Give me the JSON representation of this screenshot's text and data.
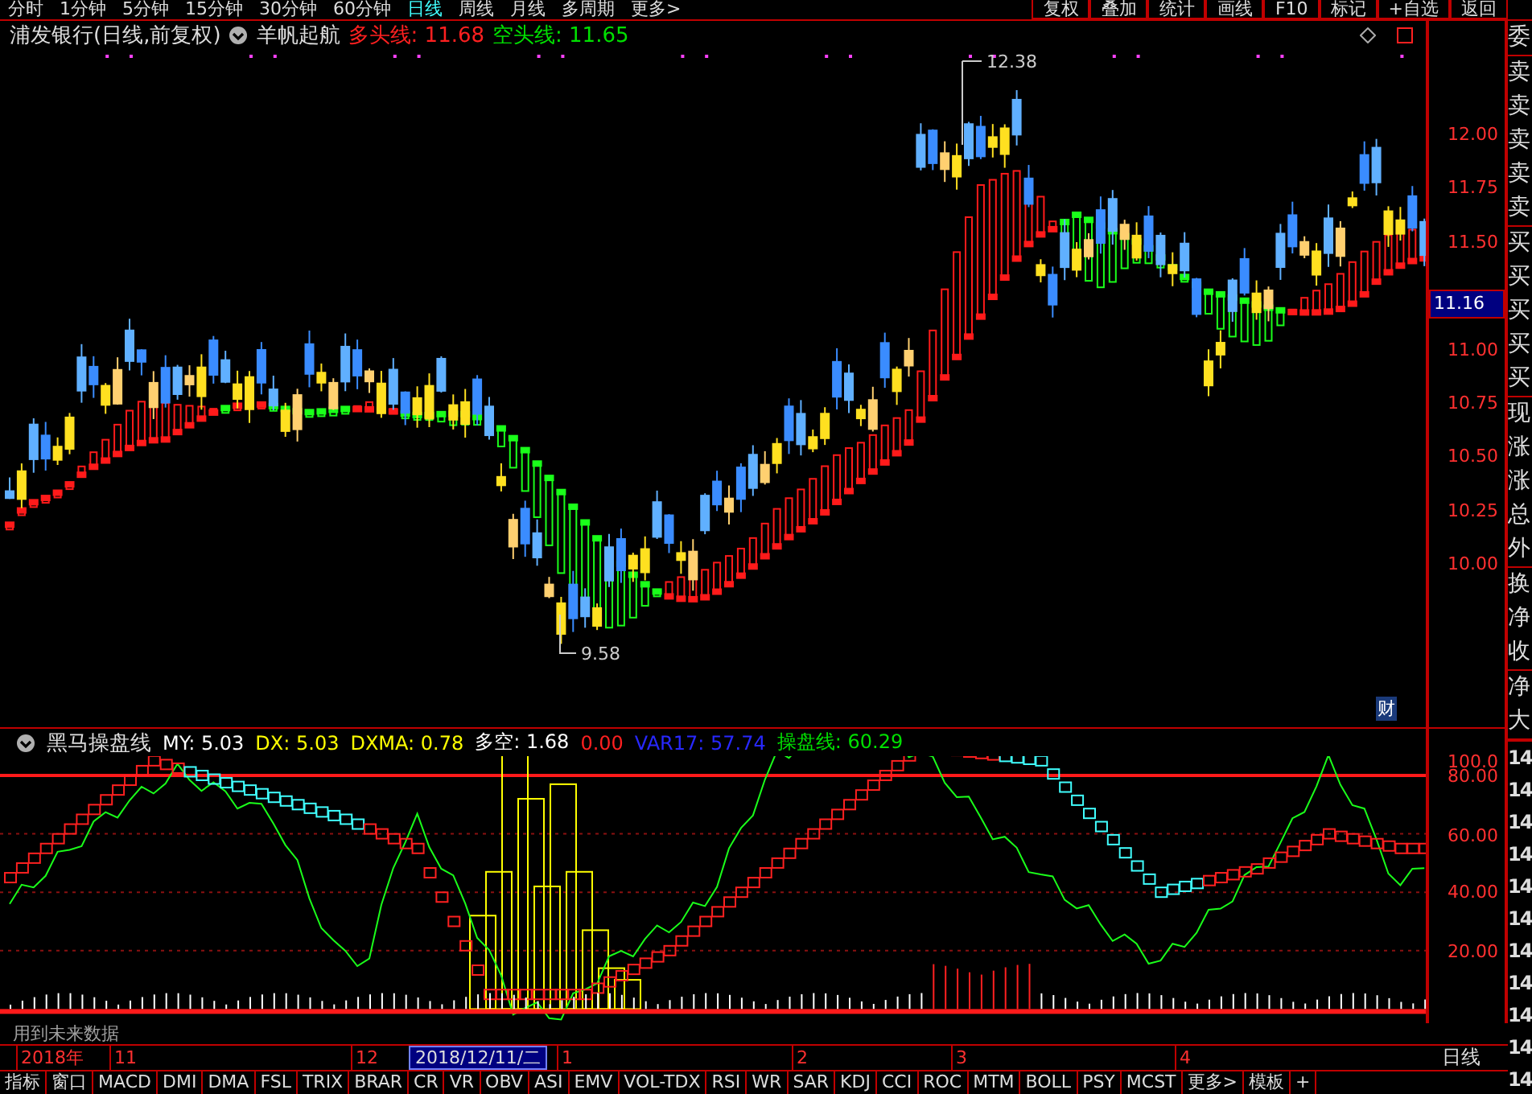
{
  "menu": {
    "periods": [
      {
        "label": "分时",
        "selected": false
      },
      {
        "label": "1分钟",
        "selected": false
      },
      {
        "label": "5分钟",
        "selected": false
      },
      {
        "label": "15分钟",
        "selected": false
      },
      {
        "label": "30分钟",
        "selected": false
      },
      {
        "label": "60分钟",
        "selected": false
      },
      {
        "label": "日线",
        "selected": true
      },
      {
        "label": "周线",
        "selected": false
      },
      {
        "label": "月线",
        "selected": false
      },
      {
        "label": "多周期",
        "selected": false
      },
      {
        "label": "更多>",
        "selected": false
      }
    ],
    "tools": [
      "复权",
      "叠加",
      "统计",
      "画线",
      "F10",
      "标记",
      "+自选",
      "返回"
    ]
  },
  "title": {
    "name": "浦发银行(日线,前复权)",
    "indicator": "羊帆起航",
    "values": [
      {
        "text": "多头线: 11.68",
        "color": "#ff2020"
      },
      {
        "text": "空头线: 11.65",
        "color": "#00e000"
      }
    ]
  },
  "price_chart": {
    "high_label": "12.38",
    "low_label": "9.58",
    "badge": "财",
    "axis": [
      "12.00",
      "11.75",
      "11.50",
      "11.00",
      "10.75",
      "10.50",
      "10.25",
      "10.00"
    ],
    "current": "11.16"
  },
  "indicator_panel": {
    "name": "黑马操盘线",
    "values": [
      {
        "text": "MY: 5.03",
        "color": "#ffffff"
      },
      {
        "text": "DX: 5.03",
        "color": "#ffff00"
      },
      {
        "text": "DXMA: 0.78",
        "color": "#ffff00"
      },
      {
        "text": "多空: 1.68",
        "color": "#ffffff"
      },
      {
        "text": "0.00",
        "color": "#ff2020"
      },
      {
        "text": "VAR17: 57.74",
        "color": "#2828ff"
      },
      {
        "text": "操盘线: 60.29",
        "color": "#00e000"
      }
    ],
    "axis": [
      "100.0",
      "80.00",
      "60.00",
      "40.00",
      "20.00"
    ]
  },
  "future_note": "用到未来数据",
  "time_axis": [
    {
      "text": "2018年",
      "kind": "year"
    },
    {
      "text": "11",
      "kind": "month"
    },
    {
      "text": "12",
      "kind": "month"
    },
    {
      "text": "2018/12/11/二",
      "kind": "cursor"
    },
    {
      "text": "1",
      "kind": "month"
    },
    {
      "text": "2",
      "kind": "month"
    },
    {
      "text": "3",
      "kind": "month"
    },
    {
      "text": "4",
      "kind": "month"
    }
  ],
  "period_label": "日线",
  "indicator_tabs": [
    "指标",
    "窗口",
    "MACD",
    "DMI",
    "DMA",
    "FSL",
    "TRIX",
    "BRAR",
    "CR",
    "VR",
    "OBV",
    "ASI",
    "EMV",
    "VOL-TDX",
    "RSI",
    "WR",
    "SAR",
    "KDJ",
    "CCI",
    "ROC",
    "MTM",
    "BOLL",
    "PSY",
    "MCST",
    "更多>",
    "模板",
    "+"
  ],
  "sidebar": {
    "groups": [
      [
        "委"
      ],
      [
        "卖",
        "卖",
        "卖",
        "卖",
        "卖"
      ],
      [
        "买",
        "买",
        "买",
        "买",
        "买"
      ],
      [
        "现",
        "涨",
        "涨",
        "总",
        "外"
      ],
      [
        "换",
        "净",
        "收"
      ],
      [
        "净",
        "大"
      ]
    ],
    "values": [
      "14",
      "14",
      "14",
      "14",
      "14",
      "14",
      "14",
      "14",
      "14",
      "14",
      "14"
    ]
  }
}
